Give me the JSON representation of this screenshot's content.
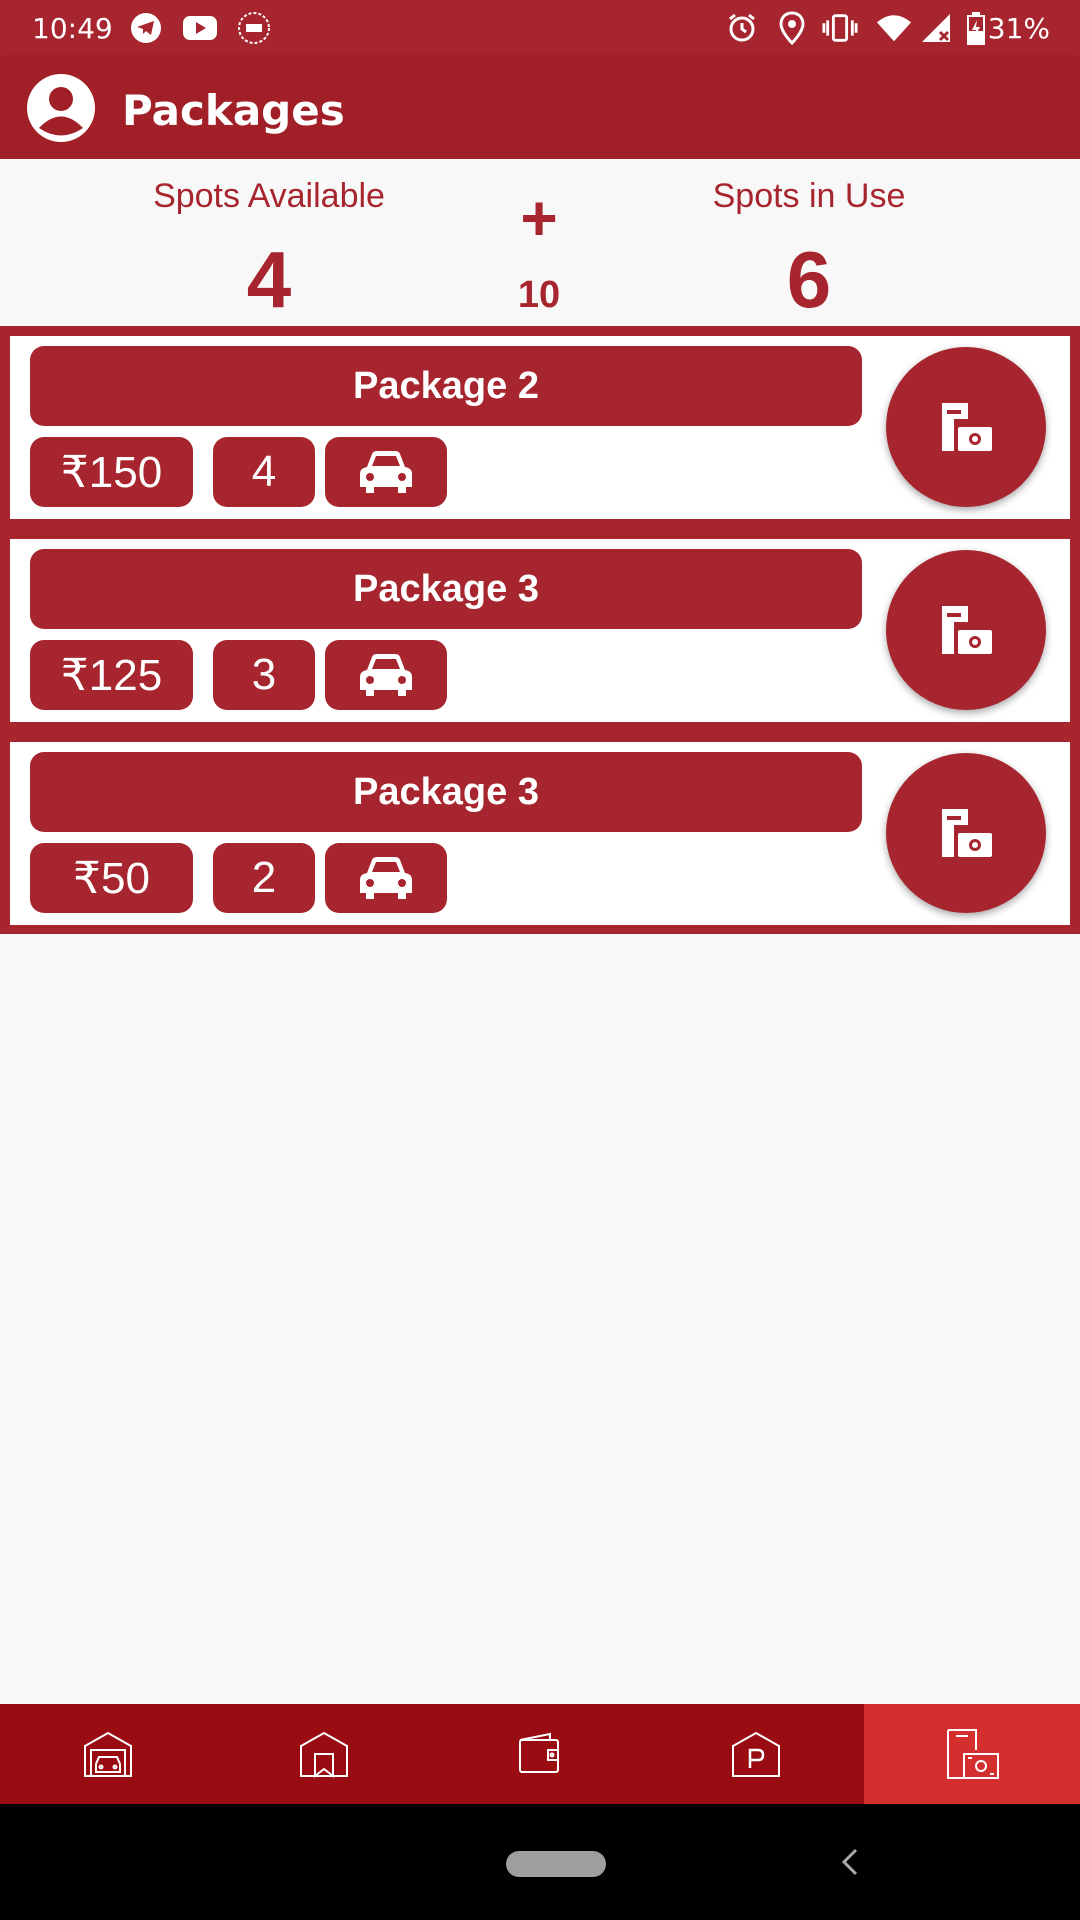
{
  "status_bar": {
    "time": "10:49",
    "battery": "31%",
    "icons": [
      "telegram-icon",
      "youtube-icon",
      "app-icon",
      "alarm-icon",
      "location-icon",
      "vibrate-icon",
      "wifi-icon",
      "signal-icon",
      "battery-icon"
    ]
  },
  "app_bar": {
    "title": "Packages",
    "account_icon": "account-circle-icon"
  },
  "summary": {
    "available_label": "Spots Available",
    "available_value": "4",
    "plus": "+",
    "total": "10",
    "in_use_label": "Spots in Use",
    "in_use_value": "6"
  },
  "packages": [
    {
      "name": "Package 2",
      "price": "₹150",
      "count": "4",
      "vehicle_icon": "car-icon",
      "action_icon": "package-pay-icon"
    },
    {
      "name": "Package 3",
      "price": "₹125",
      "count": "3",
      "vehicle_icon": "car-icon",
      "action_icon": "package-pay-icon"
    },
    {
      "name": "Package 3",
      "price": "₹50",
      "count": "2",
      "vehicle_icon": "car-icon",
      "action_icon": "package-pay-icon"
    }
  ],
  "bottom_nav": {
    "items": [
      {
        "icon": "garage-car-icon"
      },
      {
        "icon": "garage-bookmark-icon"
      },
      {
        "icon": "wallet-icon"
      },
      {
        "icon": "parking-icon"
      },
      {
        "icon": "package-pay-icon"
      }
    ],
    "active_index": 4
  },
  "colors": {
    "primary": "#a7252e",
    "app_bar": "#a11f27",
    "nav": "#990d12",
    "nav_active": "#d32f2f"
  }
}
